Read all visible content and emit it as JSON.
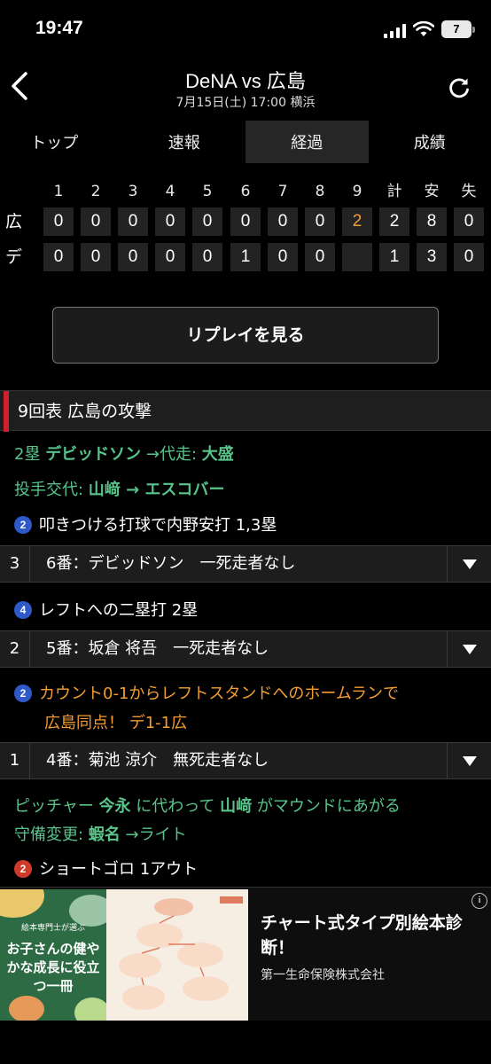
{
  "status": {
    "time": "19:47",
    "battery": "7"
  },
  "header": {
    "title": "DeNA vs 広島",
    "subtitle": "7月15日(土) 17:00 横浜"
  },
  "tabs": [
    "トップ",
    "速報",
    "経過",
    "成績"
  ],
  "scoreboard": {
    "innings": [
      "1",
      "2",
      "3",
      "4",
      "5",
      "6",
      "7",
      "8",
      "9"
    ],
    "totals_headers": [
      "計",
      "安",
      "失"
    ],
    "rows": [
      {
        "team": "広",
        "scores": [
          "0",
          "0",
          "0",
          "0",
          "0",
          "0",
          "0",
          "0",
          "2"
        ],
        "totals": [
          "2",
          "8",
          "0"
        ]
      },
      {
        "team": "デ",
        "scores": [
          "0",
          "0",
          "0",
          "0",
          "0",
          "1",
          "0",
          "0",
          ""
        ],
        "totals": [
          "1",
          "3",
          "0"
        ]
      }
    ],
    "highlight_color": "#f39c32"
  },
  "replay_button": "リプレイを見る",
  "inning_header": "9回表 広島の攻撃",
  "plays": {
    "runner_change": {
      "prefix": "2塁 ",
      "player": "デビッドソン",
      "mid": " →代走: ",
      "sub": "大盛"
    },
    "pitcher_change": {
      "prefix": "投手交代: ",
      "from": "山﨑",
      "arrow": " → ",
      "to": "エスコバー"
    },
    "p1": {
      "count": "2",
      "text": "叩きつける打球で内野安打 1,3塁"
    },
    "b1": {
      "num": "3",
      "text": "6番：デビッドソン　一死走者なし"
    },
    "p2": {
      "count": "4",
      "text": "レフトへの二塁打 2塁"
    },
    "b2": {
      "num": "2",
      "text": "5番：坂倉 将吾　一死走者なし"
    },
    "p3": {
      "count": "2",
      "line1": "カウント0-1からレフトスタンドへのホームランで",
      "line2": "広島同点！ デ1-1広"
    },
    "b3": {
      "num": "1",
      "text": "4番：菊池 涼介　無死走者なし"
    },
    "pitcher_note": {
      "a": "ピッチャー ",
      "from": "今永",
      "b": " に代わって ",
      "to": "山﨑",
      "c": " がマウンドにあがる"
    },
    "defense": {
      "prefix": "守備変更: ",
      "player": "蝦名",
      "suffix": " →ライト"
    },
    "p4": {
      "count": "2",
      "text": "ショートゴロ 1アウト"
    }
  },
  "ad": {
    "image_caption_small": "絵本専門士が選ぶ",
    "image_caption": "お子さんの健やかな成長に役立つ一冊",
    "title": "チャート式タイプ別絵本診断！",
    "sponsor": "第一生命保険株式会社",
    "info_label": "i"
  },
  "colors": {
    "accent_green": "#58c48a",
    "accent_orange": "#f39c32",
    "inning_bar": "#d0202e"
  }
}
